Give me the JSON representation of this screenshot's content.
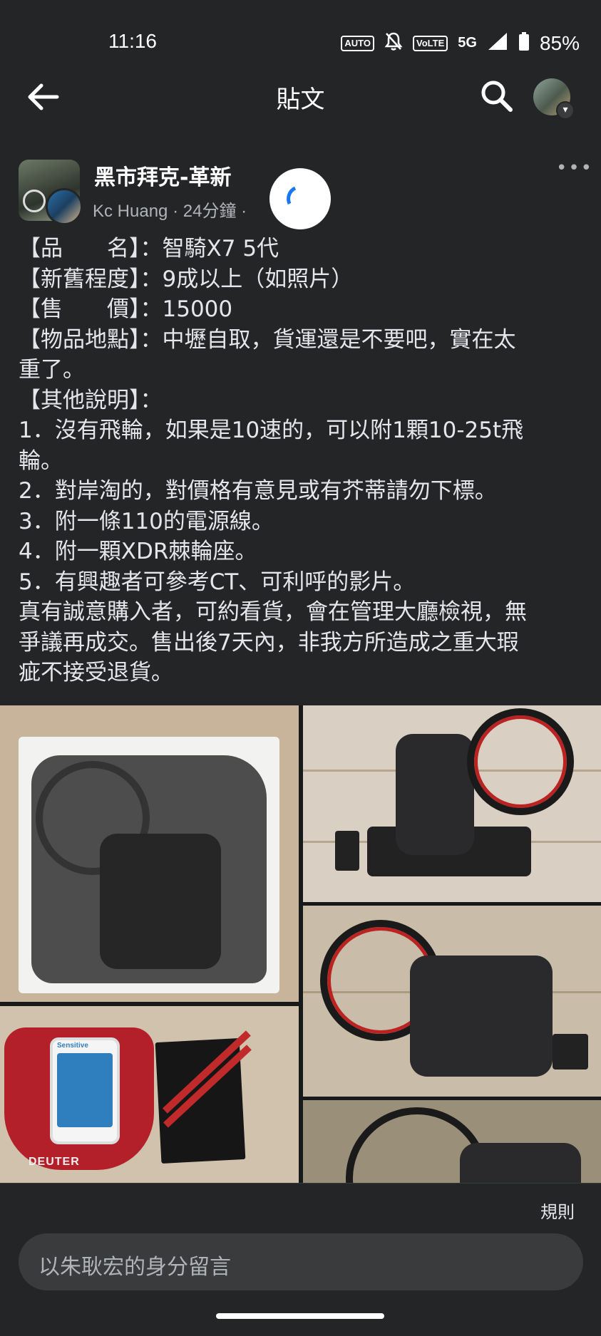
{
  "status_bar": {
    "time": "11:16",
    "auto_badge": "AUTO",
    "volte_badge": "VoLTE",
    "network": "5G",
    "battery": "85%"
  },
  "app_bar": {
    "title": "貼文"
  },
  "post": {
    "group_name": "黑市拜克-革新",
    "author": "Kc Huang",
    "time_ago": "24分鐘",
    "body_lines": [
      "【品　　名】：智騎X7 5代",
      "【新舊程度】：9成以上（如照片）",
      "【售　　價】：15000",
      "【物品地點】：中壢自取，貨運還是不要吧，實在太",
      "重了。",
      "【其他說明】：",
      "1．沒有飛輪，如果是10速的，可以附1顆10-25t飛",
      "輪。",
      "2．對岸淘的，對價格有意見或有芥蒂請勿下標。",
      "3．附一條110的電源線。",
      "4．附一顆XDR棘輪座。",
      "5．有興趣者可參考CT、可利呼的影片。",
      "真有誠意購入者，可約看貨，會在管理大廳檢視，無",
      "爭議再成交。售出後7天內，非我方所造成之重大瑕",
      "疵不接受退貨。"
    ],
    "photo_texts": {
      "phone_label": "Sensitive",
      "bag_brand": "DEUTER"
    }
  },
  "comment_bar": {
    "rules": "規則",
    "placeholder": "以朱耿宏的身分留言"
  },
  "colors": {
    "background": "#242526",
    "text_primary": "#e4e6eb",
    "text_secondary": "#b0b3b8",
    "input_bg": "#3a3b3c",
    "accent": "#1877f2"
  }
}
